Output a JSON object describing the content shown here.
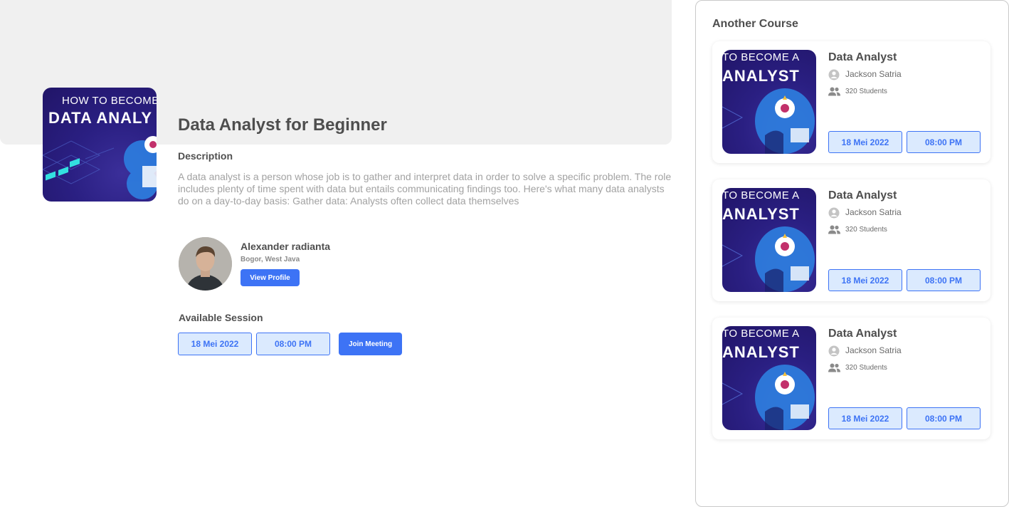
{
  "course": {
    "cover_line1": "HOW TO BECOME",
    "cover_line2": "DATA ANALY",
    "title": "Data Analyst for Beginner",
    "description_label": "Description",
    "description": "A data analyst is a person whose job is to gather and interpret data in order to solve a specific problem. The role includes plenty of time spent with data but entails communicating findings too. Here's what many data analysts do on a day-to-day basis: Gather data: Analysts often collect data themselves"
  },
  "mentor": {
    "name": "Alexander radianta",
    "location": "Bogor, West Java",
    "view_profile_label": "View Profile"
  },
  "session": {
    "label": "Available Session",
    "date": "18 Mei 2022",
    "time": "08:00 PM",
    "join_label": "Join Meeting"
  },
  "sidebar": {
    "title": "Another Course",
    "courses": [
      {
        "cover_line1": "TO BECOME A",
        "cover_line2": "ANALYST",
        "title": "Data Analyst",
        "author": "Jackson Satria",
        "students": "320 Students",
        "date": "18 Mei 2022",
        "time": "08:00 PM"
      },
      {
        "cover_line1": "TO BECOME A",
        "cover_line2": "ANALYST",
        "title": "Data Analyst",
        "author": "Jackson Satria",
        "students": "320 Students",
        "date": "18 Mei 2022",
        "time": "08:00 PM"
      },
      {
        "cover_line1": "TO BECOME A",
        "cover_line2": "ANALYST",
        "title": "Data Analyst",
        "author": "Jackson Satria",
        "students": "320 Students",
        "date": "18 Mei 2022",
        "time": "08:00 PM"
      }
    ]
  },
  "colors": {
    "accent": "#3d73f5",
    "pill_bg": "#dbeafe",
    "hero_bg": "#f0f0f0",
    "cover_bg": "#2a1f82"
  }
}
